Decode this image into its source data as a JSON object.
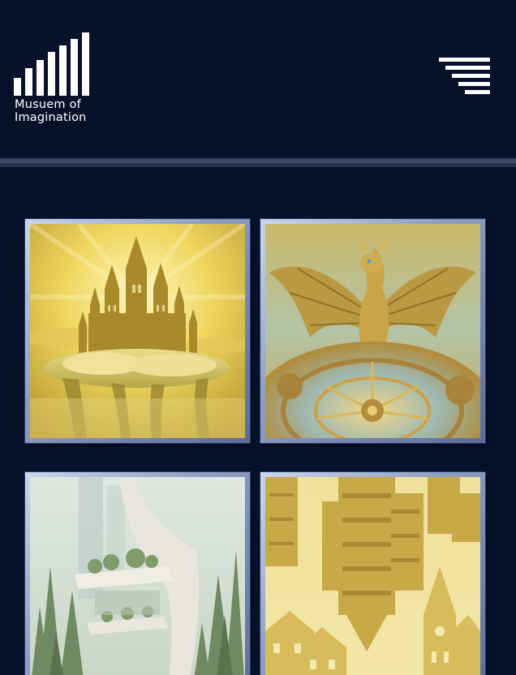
{
  "brand": {
    "line1": "Musuem of",
    "line2": "Imagination",
    "icon": "bar-chart-logo-icon"
  },
  "menu": {
    "icon": "menu-icon"
  },
  "gallery": {
    "artworks": [
      {
        "subject": "floating-golden-castle",
        "icon": "castle-artwork"
      },
      {
        "subject": "golden-dragon-on-clock",
        "icon": "dragon-artwork"
      },
      {
        "subject": "futuristic-treehouse-architecture",
        "icon": "forest-building-artwork"
      },
      {
        "subject": "floating-golden-city",
        "icon": "golden-city-artwork"
      }
    ]
  },
  "colors": {
    "background": "#07112a",
    "frame_light": "#c9d6ec",
    "frame_dark": "#5a6c9a",
    "gold": "#e6cf5a",
    "text": "#ffffff"
  }
}
